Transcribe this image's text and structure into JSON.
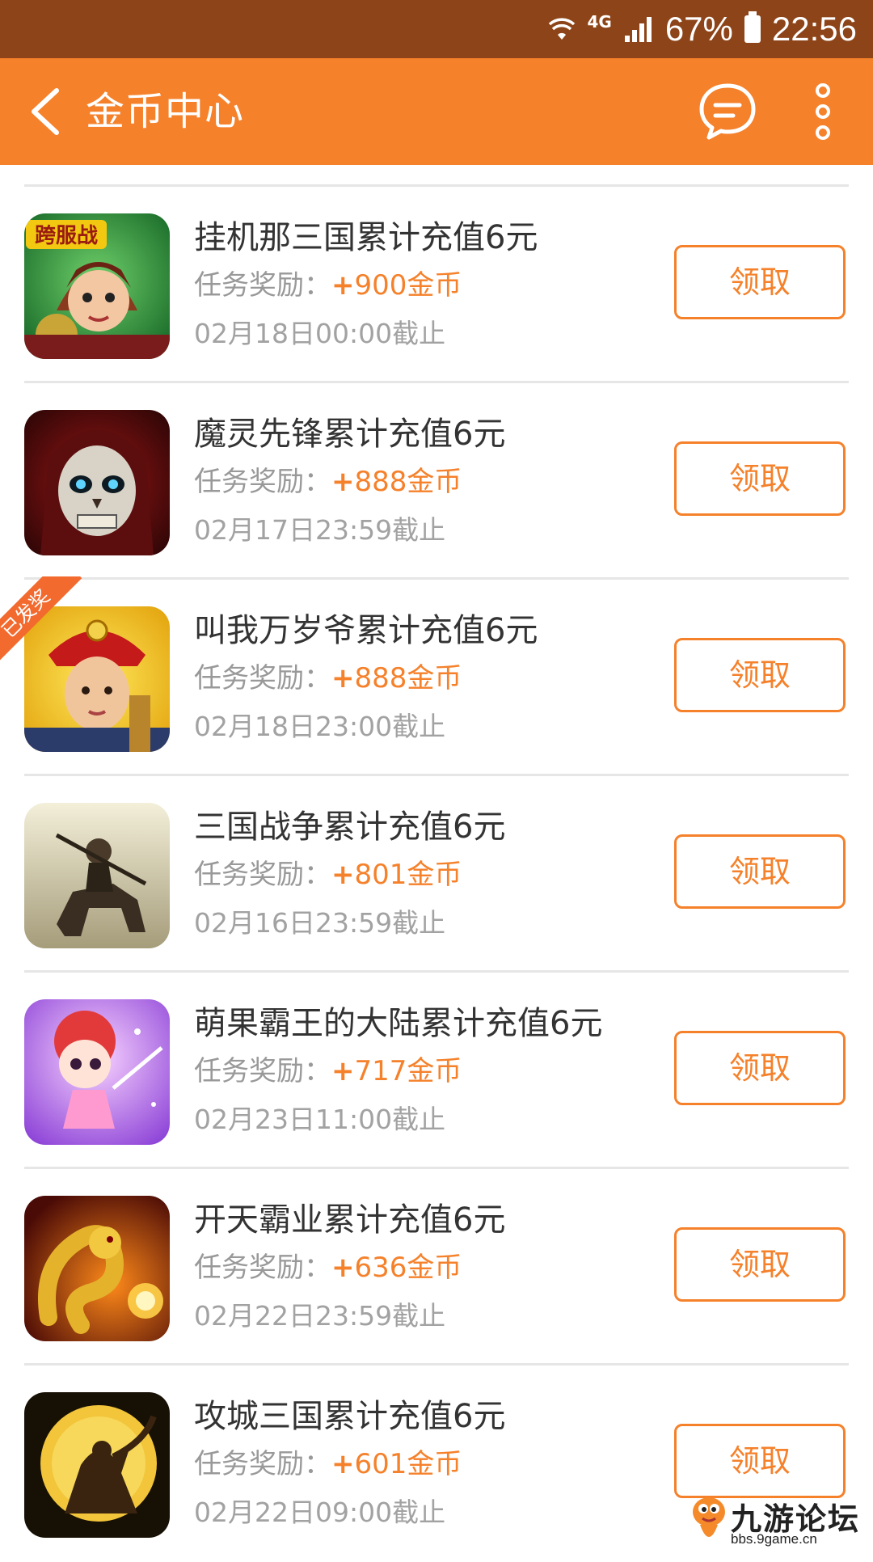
{
  "status_bar": {
    "network": "4G",
    "battery": "67%",
    "time": "22:56"
  },
  "app_bar": {
    "title": "金币中心",
    "icons": [
      "back-arrow-icon",
      "message-icon",
      "more-vertical-icon"
    ]
  },
  "colors": {
    "accent": "#f5812b",
    "status_bar": "#8d4418",
    "ribbon": "#f26a2e"
  },
  "tasks": [
    {
      "title": "挂机那三国累计充值6元",
      "reward_label": "任务奖励：",
      "plus": "+",
      "amount": "900金币",
      "deadline": "02月18日00:00截止",
      "button": "领取",
      "badge": "跨服战",
      "icon": "game-icon-gujinasanguo"
    },
    {
      "title": "魔灵先锋累计充值6元",
      "reward_label": "任务奖励：",
      "plus": "+",
      "amount": "888金币",
      "deadline": "02月17日23:59截止",
      "button": "领取",
      "icon": "game-icon-molingxianfeng"
    },
    {
      "title": "叫我万岁爷累计充值6元",
      "reward_label": "任务奖励：",
      "plus": "+",
      "amount": "888金币",
      "deadline": "02月18日23:00截止",
      "button": "领取",
      "ribbon": "已发奖",
      "icon": "game-icon-jiaowowansuiye"
    },
    {
      "title": "三国战争累计充值6元",
      "reward_label": "任务奖励：",
      "plus": "+",
      "amount": "801金币",
      "deadline": "02月16日23:59截止",
      "button": "领取",
      "icon": "game-icon-sanguozhanzheng"
    },
    {
      "title": "萌果霸王的大陆累计充值6元",
      "reward_label": "任务奖励：",
      "plus": "+",
      "amount": "717金币",
      "deadline": "02月23日11:00截止",
      "button": "领取",
      "icon": "game-icon-mengguobawang"
    },
    {
      "title": "开天霸业累计充值6元",
      "reward_label": "任务奖励：",
      "plus": "+",
      "amount": "636金币",
      "deadline": "02月22日23:59截止",
      "button": "领取",
      "icon": "game-icon-kaitianbaye"
    },
    {
      "title": "攻城三国累计充值6元",
      "reward_label": "任务奖励：",
      "plus": "+",
      "amount": "601金币",
      "deadline": "02月22日09:00截止",
      "button": "领取",
      "icon": "game-icon-gongchengsanguo"
    }
  ],
  "watermark": {
    "name": "九游论坛",
    "url": "bbs.9game.cn"
  }
}
